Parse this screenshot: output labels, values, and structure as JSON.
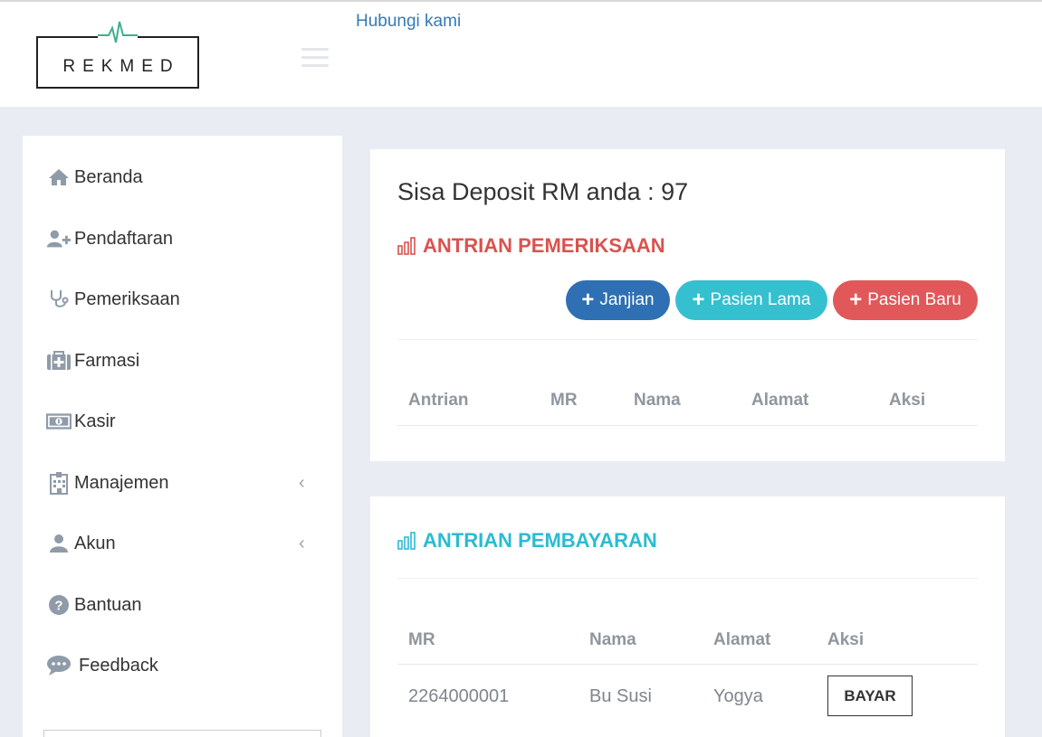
{
  "header": {
    "logo_text": "REKMED",
    "contact_link": "Hubungi kami"
  },
  "sidebar": {
    "items": [
      {
        "label": "Beranda",
        "icon": "home-icon"
      },
      {
        "label": "Pendaftaran",
        "icon": "user-plus-icon"
      },
      {
        "label": "Pemeriksaan",
        "icon": "stethoscope-icon"
      },
      {
        "label": "Farmasi",
        "icon": "medkit-icon"
      },
      {
        "label": "Kasir",
        "icon": "money-icon"
      },
      {
        "label": "Manajemen",
        "icon": "hospital-icon",
        "caret": "‹"
      },
      {
        "label": "Akun",
        "icon": "user-icon",
        "caret": "‹"
      },
      {
        "label": "Bantuan",
        "icon": "question-circle-icon"
      },
      {
        "label": "Feedback",
        "icon": "comment-icon"
      }
    ]
  },
  "main": {
    "deposit_text": "Sisa Deposit RM anda : 97",
    "queue_exam": {
      "title": "ANTRIAN PEMERIKSAAN",
      "buttons": {
        "janjian": "Janjian",
        "pasien_lama": "Pasien Lama",
        "pasien_baru": "Pasien Baru"
      },
      "columns": [
        "Antrian",
        "MR",
        "Nama",
        "Alamat",
        "Aksi"
      ]
    },
    "queue_payment": {
      "title": "ANTRIAN PEMBAYARAN",
      "columns": [
        "MR",
        "Nama",
        "Alamat",
        "Aksi"
      ],
      "rows": [
        {
          "mr": "2264000001",
          "nama": "Bu Susi",
          "alamat": "Yogya",
          "aksi": "BAYAR"
        }
      ]
    }
  },
  "colors": {
    "accent_blue": "#2e70b3",
    "accent_cyan": "#35c0d0",
    "accent_red": "#e0585a",
    "link": "#337ab7"
  }
}
